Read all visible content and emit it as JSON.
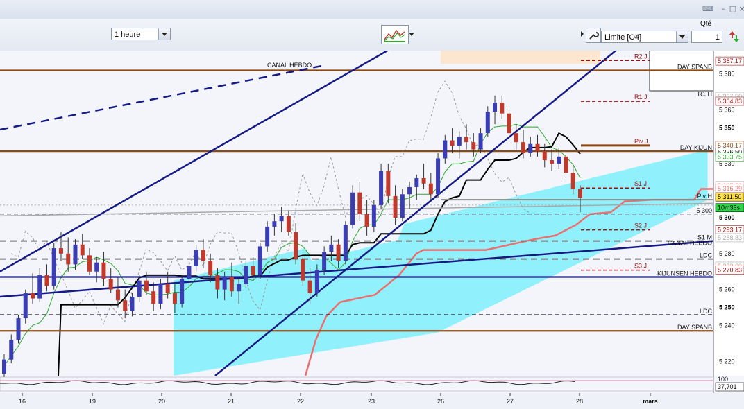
{
  "toolbar": {
    "timeframe": "1 heure",
    "order_type": "Limite [O4]",
    "qty_label": "Qté",
    "qty_value": "1"
  },
  "colors": {
    "bull": "#3a3db4",
    "bear": "#c0392b",
    "cloud": "#7ef0fb",
    "kijun": "#000000",
    "tenkan": "#2eaa2e",
    "senkou_b": "#ec6f6f",
    "hebdo_line": "#161a85",
    "span_line": "#8b4a14",
    "pivot_red": "#a01010"
  },
  "chart_data": {
    "type": "candlestick",
    "instrument_price_axis": {
      "ylim": [
        5212,
        5393
      ]
    },
    "x_ticks": [
      "16",
      "19",
      "20",
      "21",
      "22",
      "23",
      "26",
      "27",
      "28",
      "mars"
    ],
    "y_ticks": [
      "5 380",
      "5 360",
      "5 350",
      "5 330",
      "5 300",
      "5 280",
      "5 260",
      "5 250",
      "5 240",
      "5 220"
    ],
    "price_tags": [
      {
        "text": "5 387,17",
        "value": 5387.17,
        "style": "red"
      },
      {
        "text": "5 367,50",
        "value": 5367.5,
        "style": "grey"
      },
      {
        "text": "5 364,83",
        "value": 5364.83,
        "style": "red"
      },
      {
        "text": "5 340,17",
        "value": 5340.17,
        "style": "brown"
      },
      {
        "text": "5 336,50",
        "value": 5336.5,
        "style": "black"
      },
      {
        "text": "5 333,75",
        "value": 5333.75,
        "style": "green"
      },
      {
        "text": "5 317,83",
        "value": 5317.83,
        "style": "grey"
      },
      {
        "text": "5 316,29",
        "value": 5316.29,
        "style": "pink"
      },
      {
        "text": "5 311,50",
        "value": 5311.5,
        "style": "yellow"
      },
      {
        "text": "10m33s",
        "value": 5305.5,
        "style": "green-fill"
      },
      {
        "text": "5 293,17",
        "value": 5293.17,
        "style": "red"
      },
      {
        "text": "5 288,83",
        "value": 5288.83,
        "style": "grey"
      },
      {
        "text": "5 273,00",
        "value": 5273.0,
        "style": "grey"
      },
      {
        "text": "5 270,83",
        "value": 5270.83,
        "style": "red"
      }
    ],
    "level_labels": [
      {
        "text": "DAY SPANB",
        "value": 5382
      },
      {
        "text": "DAY KIJUN",
        "value": 5337
      },
      {
        "text": "CANAL HEBDO",
        "value": 5284
      },
      {
        "text": "LDC",
        "value": 5277
      },
      {
        "text": "KIJUNSEN HEBDO",
        "value": 5267
      },
      {
        "text": "LDC",
        "value": 5246
      },
      {
        "text": "DAY SPANB",
        "value": 5237
      },
      {
        "text": "5 300",
        "value": 5302
      },
      {
        "text": "Piv H",
        "value": 5310
      },
      {
        "text": "S1 M",
        "value": 5287
      },
      {
        "text": "R1 H",
        "value": 5367
      }
    ],
    "pivots": [
      {
        "text": "R2 J",
        "value": 5387.5
      },
      {
        "text": "R1 J",
        "value": 5364.8
      },
      {
        "text": "Piv J",
        "value": 5340.2
      },
      {
        "text": "S1 J",
        "value": 5316.5
      },
      {
        "text": "S2 J",
        "value": 5293.2
      },
      {
        "text": "S3 J",
        "value": 5270.8
      }
    ],
    "canal_hebdo_label": "CANAL HEBDO",
    "horizontal_levels": [
      {
        "value": 5382,
        "style": "brown-solid"
      },
      {
        "value": 5337,
        "style": "brown-solid"
      },
      {
        "value": 5237,
        "style": "brown-solid"
      },
      {
        "value": 5267,
        "style": "navy-solid"
      },
      {
        "value": 5277,
        "style": "grey-dash"
      },
      {
        "value": 5302,
        "style": "dark-dash"
      },
      {
        "value": 5307,
        "style": "grey-dot"
      },
      {
        "value": 5246,
        "style": "dark-dash"
      },
      {
        "value": 5287,
        "style": "grey-dash"
      }
    ],
    "candles": [
      [
        5213,
        5224,
        5211,
        5221
      ],
      [
        5221,
        5235,
        5219,
        5232
      ],
      [
        5232,
        5246,
        5230,
        5244
      ],
      [
        5244,
        5260,
        5241,
        5258
      ],
      [
        5258,
        5269,
        5252,
        5255
      ],
      [
        5255,
        5272,
        5253,
        5268
      ],
      [
        5268,
        5274,
        5259,
        5262
      ],
      [
        5262,
        5286,
        5260,
        5283
      ],
      [
        5283,
        5292,
        5276,
        5280
      ],
      [
        5280,
        5289,
        5270,
        5274
      ],
      [
        5274,
        5288,
        5271,
        5285
      ],
      [
        5285,
        5291,
        5277,
        5279
      ],
      [
        5279,
        5283,
        5268,
        5270
      ],
      [
        5270,
        5278,
        5264,
        5275
      ],
      [
        5275,
        5281,
        5262,
        5266
      ],
      [
        5266,
        5272,
        5258,
        5260
      ],
      [
        5260,
        5267,
        5250,
        5254
      ],
      [
        5254,
        5260,
        5244,
        5248
      ],
      [
        5248,
        5258,
        5245,
        5256
      ],
      [
        5256,
        5268,
        5253,
        5265
      ],
      [
        5265,
        5270,
        5257,
        5259
      ],
      [
        5259,
        5264,
        5248,
        5252
      ],
      [
        5252,
        5266,
        5249,
        5263
      ],
      [
        5263,
        5270,
        5255,
        5258
      ],
      [
        5258,
        5263,
        5247,
        5252
      ],
      [
        5252,
        5268,
        5250,
        5266
      ],
      [
        5266,
        5276,
        5262,
        5273
      ],
      [
        5273,
        5285,
        5270,
        5282
      ],
      [
        5282,
        5288,
        5272,
        5276
      ],
      [
        5276,
        5280,
        5264,
        5268
      ],
      [
        5268,
        5272,
        5255,
        5260
      ],
      [
        5260,
        5270,
        5254,
        5267
      ],
      [
        5267,
        5275,
        5256,
        5259
      ],
      [
        5259,
        5266,
        5252,
        5263
      ],
      [
        5263,
        5276,
        5261,
        5273
      ],
      [
        5273,
        5278,
        5265,
        5268
      ],
      [
        5268,
        5286,
        5266,
        5284
      ],
      [
        5284,
        5298,
        5281,
        5295
      ],
      [
        5295,
        5302,
        5290,
        5298
      ],
      [
        5298,
        5306,
        5292,
        5301
      ],
      [
        5301,
        5304,
        5290,
        5292
      ],
      [
        5292,
        5297,
        5274,
        5277
      ],
      [
        5277,
        5280,
        5262,
        5265
      ],
      [
        5265,
        5272,
        5252,
        5258
      ],
      [
        5258,
        5274,
        5256,
        5271
      ],
      [
        5271,
        5284,
        5268,
        5281
      ],
      [
        5281,
        5290,
        5276,
        5285
      ],
      [
        5285,
        5288,
        5272,
        5276
      ],
      [
        5276,
        5298,
        5274,
        5296
      ],
      [
        5296,
        5318,
        5294,
        5314
      ],
      [
        5314,
        5320,
        5298,
        5302
      ],
      [
        5302,
        5310,
        5290,
        5295
      ],
      [
        5295,
        5310,
        5292,
        5307
      ],
      [
        5307,
        5330,
        5305,
        5326
      ],
      [
        5326,
        5330,
        5308,
        5312
      ],
      [
        5312,
        5318,
        5296,
        5300
      ],
      [
        5300,
        5316,
        5298,
        5313
      ],
      [
        5313,
        5320,
        5305,
        5317
      ],
      [
        5317,
        5324,
        5310,
        5322
      ],
      [
        5322,
        5330,
        5316,
        5319
      ],
      [
        5319,
        5325,
        5310,
        5313
      ],
      [
        5313,
        5336,
        5311,
        5333
      ],
      [
        5333,
        5346,
        5330,
        5343
      ],
      [
        5343,
        5350,
        5336,
        5340
      ],
      [
        5340,
        5348,
        5333,
        5345
      ],
      [
        5345,
        5352,
        5338,
        5342
      ],
      [
        5342,
        5347,
        5334,
        5338
      ],
      [
        5338,
        5350,
        5336,
        5347
      ],
      [
        5347,
        5362,
        5345,
        5359
      ],
      [
        5359,
        5368,
        5352,
        5364
      ],
      [
        5364,
        5368,
        5355,
        5358
      ],
      [
        5358,
        5362,
        5344,
        5347
      ],
      [
        5347,
        5352,
        5338,
        5342
      ],
      [
        5342,
        5349,
        5333,
        5336
      ],
      [
        5336,
        5345,
        5334,
        5341
      ],
      [
        5341,
        5346,
        5334,
        5337
      ],
      [
        5337,
        5341,
        5328,
        5332
      ],
      [
        5332,
        5338,
        5326,
        5330
      ],
      [
        5330,
        5339,
        5327,
        5334
      ],
      [
        5334,
        5337,
        5322,
        5325
      ],
      [
        5325,
        5329,
        5313,
        5316
      ],
      [
        5316,
        5318,
        5303,
        5311
      ]
    ],
    "overlays": [
      "kijun",
      "tenkan",
      "senkou_a",
      "senkou_b",
      "chikou",
      "ichimoku_cloud"
    ],
    "lower_panel": {
      "label": "100",
      "value_tag": "37,701"
    }
  }
}
